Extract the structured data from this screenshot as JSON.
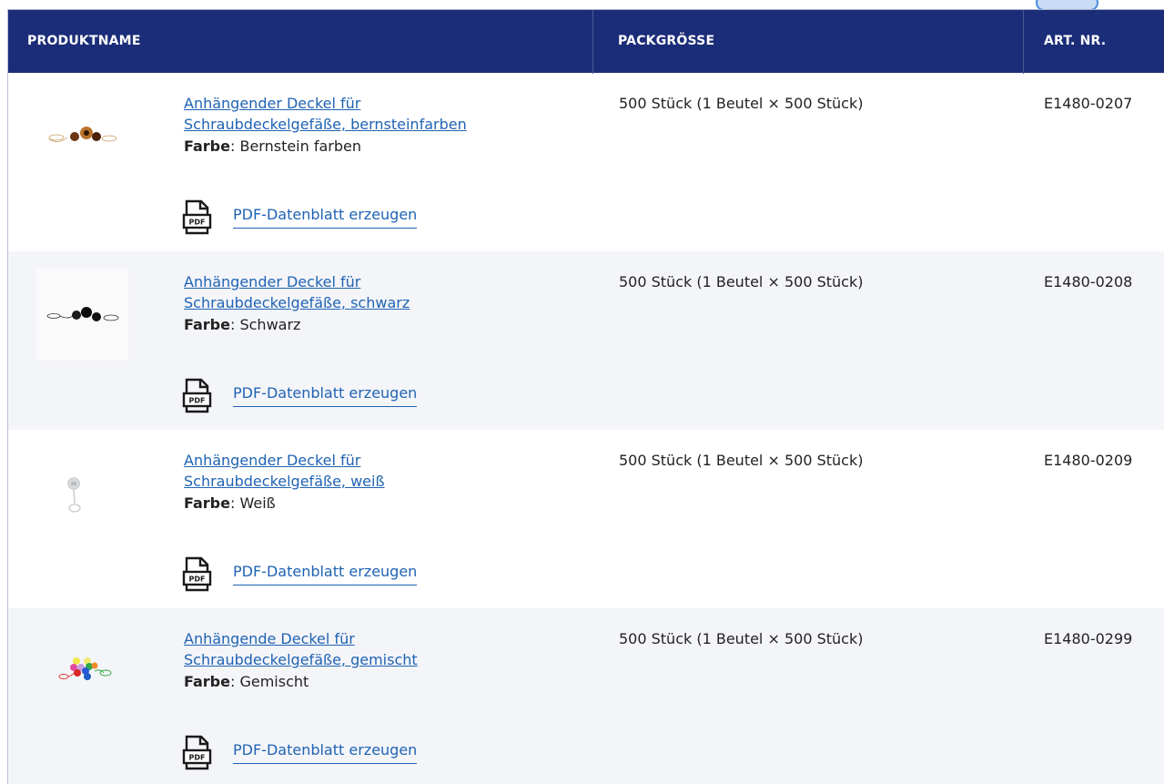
{
  "header": {
    "col_name": "PRODUKTNAME",
    "col_pack": "PACKGRÖSSE",
    "col_art": "ART. NR."
  },
  "colors": {
    "header_bg": "#1b2d78",
    "link": "#1f63b3",
    "row_alt_bg": "#f4f5f9"
  },
  "rows": [
    {
      "name_line1": "Anhängender Deckel für",
      "name_line2": "Schraubdeckelgefäße, bernsteinfarben",
      "color_label": "Farbe",
      "color_value": "Bernstein farben",
      "pdf_label": "PDF-Datenblatt erzeugen",
      "pack": "500 Stück (1 Beutel × 500 Stück)",
      "art": "E1480-0207",
      "thumb": "amber-caps-image",
      "pdf_icon_text": "PDF"
    },
    {
      "name_line1": "Anhängender Deckel für",
      "name_line2": "Schraubdeckelgefäße, schwarz",
      "color_label": "Farbe",
      "color_value": "Schwarz",
      "pdf_label": "PDF-Datenblatt erzeugen",
      "pack": "500 Stück (1 Beutel × 500 Stück)",
      "art": "E1480-0208",
      "thumb": "black-caps-image",
      "pdf_icon_text": "PDF"
    },
    {
      "name_line1": "Anhängender Deckel für",
      "name_line2": "Schraubdeckelgefäße, weiß",
      "color_label": "Farbe",
      "color_value": "Weiß",
      "pdf_label": "PDF-Datenblatt erzeugen",
      "pack": "500 Stück (1 Beutel × 500 Stück)",
      "art": "E1480-0209",
      "thumb": "white-cap-image",
      "pdf_icon_text": "PDF"
    },
    {
      "name_line1": "Anhängende Deckel für",
      "name_line2": "Schraubdeckelgefäße, gemischt",
      "color_label": "Farbe",
      "color_value": "Gemischt",
      "pdf_label": "PDF-Datenblatt erzeugen",
      "pack": "500 Stück (1 Beutel × 500 Stück)",
      "art": "E1480-0299",
      "thumb": "mixed-caps-image",
      "pdf_icon_text": "PDF"
    }
  ]
}
